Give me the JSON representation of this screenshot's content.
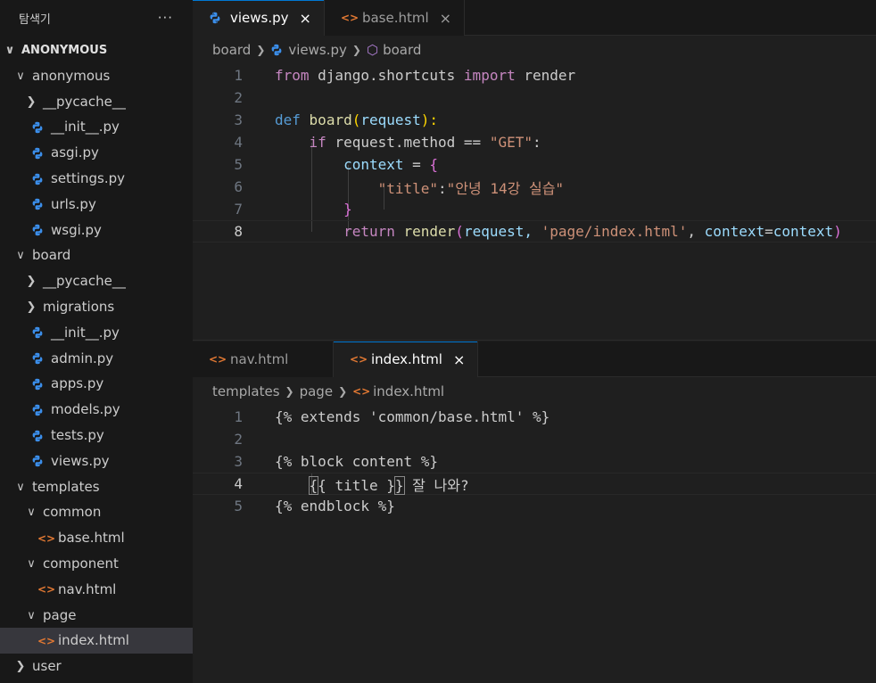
{
  "explorer": {
    "title": "탐색기",
    "more": "···",
    "root": "ANONYMOUS",
    "items": [
      {
        "label": "anonymous",
        "type": "folder",
        "open": true,
        "depth": 1
      },
      {
        "label": "__pycache__",
        "type": "folder",
        "open": false,
        "depth": 2
      },
      {
        "label": "__init__.py",
        "type": "py",
        "depth": 2
      },
      {
        "label": "asgi.py",
        "type": "py",
        "depth": 2
      },
      {
        "label": "settings.py",
        "type": "py",
        "depth": 2
      },
      {
        "label": "urls.py",
        "type": "py",
        "depth": 2
      },
      {
        "label": "wsgi.py",
        "type": "py",
        "depth": 2
      },
      {
        "label": "board",
        "type": "folder",
        "open": true,
        "depth": 1
      },
      {
        "label": "__pycache__",
        "type": "folder",
        "open": false,
        "depth": 2
      },
      {
        "label": "migrations",
        "type": "folder",
        "open": false,
        "depth": 2
      },
      {
        "label": "__init__.py",
        "type": "py",
        "depth": 2
      },
      {
        "label": "admin.py",
        "type": "py",
        "depth": 2
      },
      {
        "label": "apps.py",
        "type": "py",
        "depth": 2
      },
      {
        "label": "models.py",
        "type": "py",
        "depth": 2
      },
      {
        "label": "tests.py",
        "type": "py",
        "depth": 2
      },
      {
        "label": "views.py",
        "type": "py",
        "depth": 2
      },
      {
        "label": "templates",
        "type": "folder",
        "open": true,
        "depth": 1
      },
      {
        "label": "common",
        "type": "folder",
        "open": true,
        "depth": 2
      },
      {
        "label": "base.html",
        "type": "html",
        "depth": 3
      },
      {
        "label": "component",
        "type": "folder",
        "open": true,
        "depth": 2
      },
      {
        "label": "nav.html",
        "type": "html",
        "depth": 3
      },
      {
        "label": "page",
        "type": "folder",
        "open": true,
        "depth": 2
      },
      {
        "label": "index.html",
        "type": "html",
        "depth": 3,
        "selected": true
      },
      {
        "label": "user",
        "type": "folder",
        "open": false,
        "depth": 1
      }
    ]
  },
  "top_editor": {
    "tabs": [
      {
        "label": "views.py",
        "type": "py",
        "active": true,
        "close": "×"
      },
      {
        "label": "base.html",
        "type": "html",
        "active": false,
        "close": "×"
      }
    ],
    "breadcrumb": [
      "board",
      "views.py",
      "board"
    ],
    "lines": [
      "1",
      "2",
      "3",
      "4",
      "5",
      "6",
      "7",
      "8"
    ],
    "current_line": "8",
    "code": {
      "l1_from": "from",
      "l1_mod": " django.shortcuts ",
      "l1_import": "import",
      "l1_name": " render",
      "l3_def": "def",
      "l3_fn": "board",
      "l3_p1": "(",
      "l3_param": "request",
      "l3_p2": "):",
      "l4_if": "if",
      "l4_rest": " request.method == ",
      "l4_str": "\"GET\"",
      "l4_colon": ":",
      "l5_var": "context",
      "l5_eq": " = ",
      "l5_brace": "{",
      "l6_key": "\"title\"",
      "l6_colon": ":",
      "l6_val": "\"안녕 14강 실습\"",
      "l7_brace": "}",
      "l8_return": "return",
      "l8_fn": "render",
      "l8_p1": "(",
      "l8_arg1": "request, ",
      "l8_str": "'page/index.html'",
      "l8_comma": ", ",
      "l8_kw": "context",
      "l8_eq": "=",
      "l8_val": "context",
      "l8_p2": ")"
    }
  },
  "bottom_editor": {
    "tabs": [
      {
        "label": "nav.html",
        "type": "html",
        "active": false,
        "close": ""
      },
      {
        "label": "index.html",
        "type": "html",
        "active": true,
        "close": "×"
      }
    ],
    "breadcrumb": [
      "templates",
      "page",
      "index.html"
    ],
    "lines": [
      "1",
      "2",
      "3",
      "4",
      "5"
    ],
    "current_line": "4",
    "code": {
      "l1": "{% extends 'common/base.html' %}",
      "l3": "{% block content %}",
      "l4_open": "{",
      "l4_mid": "{ title }",
      "l4_close": "}",
      "l4_text": " 잘 나와?",
      "l5": "{% endblock %}"
    }
  },
  "colors": {
    "accent": "#0078d4",
    "python_icon": "#3b8eea",
    "html_icon": "#e37933"
  }
}
